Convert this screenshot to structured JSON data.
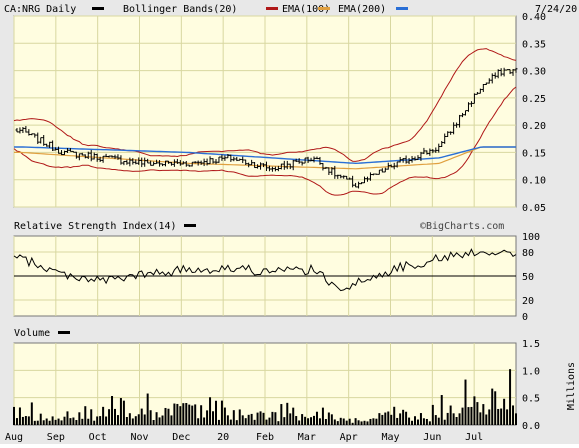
{
  "header": {
    "symbol": "CA:NRG Daily",
    "bollinger": "Bollinger Bands(20)",
    "ema100": "EMA(100)",
    "ema200": "EMA(200)",
    "date": "7/24/20"
  },
  "rsi_panel": {
    "title": "Relative Strength Index(14)",
    "watermark": "©BigCharts.com"
  },
  "volume_panel": {
    "title": "Volume",
    "unit": "Millions"
  },
  "colors": {
    "plot_bg": "#fffde0",
    "grid": "#d8d7a0",
    "price": "#000000",
    "bollinger": "#b01818",
    "ema100": "#e0a040",
    "ema200": "#2a6fd6",
    "volume": "#000000"
  },
  "chart_data": [
    {
      "type": "ohlc",
      "title": "CA:NRG Daily",
      "x_tick_labels": [
        "Aug",
        "Sep",
        "Oct",
        "Nov",
        "Dec",
        "20",
        "Feb",
        "Mar",
        "Apr",
        "May",
        "Jun",
        "Jul"
      ],
      "y_tick_labels": [
        "0.40",
        "0.35",
        "0.30",
        "0.25",
        "0.20",
        "0.15",
        "0.10",
        "0.05"
      ],
      "ylim": [
        0.05,
        0.4
      ],
      "grid": true,
      "series": [
        {
          "name": "Bollinger Bands(20)",
          "key": "bollinger"
        },
        {
          "name": "EMA(100)",
          "key": "ema100"
        },
        {
          "name": "EMA(200)",
          "key": "ema200"
        }
      ],
      "price_points": [
        [
          "Aug",
          0.19
        ],
        [
          "Sep",
          0.15
        ],
        [
          "Oct",
          0.14
        ],
        [
          "Nov",
          0.13
        ],
        [
          "Dec",
          0.13
        ],
        [
          "20",
          0.14
        ],
        [
          "Feb",
          0.12
        ],
        [
          "Mar",
          0.14
        ],
        [
          "Mar",
          0.11
        ],
        [
          "Apr",
          0.09
        ],
        [
          "Apr",
          0.11
        ],
        [
          "May",
          0.13
        ],
        [
          "Jun",
          0.16
        ],
        [
          "Jul",
          0.27
        ],
        [
          "Jul",
          0.3
        ]
      ],
      "ema100_points": [
        [
          "Aug",
          0.15
        ],
        [
          "Dec",
          0.13
        ],
        [
          "Apr",
          0.12
        ],
        [
          "Jun",
          0.13
        ],
        [
          "Jul",
          0.16
        ]
      ],
      "ema200_points": [
        [
          "Aug",
          0.16
        ],
        [
          "Dec",
          0.15
        ],
        [
          "Apr",
          0.13
        ],
        [
          "Jun",
          0.14
        ],
        [
          "Jul",
          0.16
        ]
      ]
    },
    {
      "type": "line",
      "title": "Relative Strength Index(14)",
      "y_tick_labels": [
        "100",
        "80",
        "50",
        "20",
        "0"
      ],
      "ylim": [
        0,
        100
      ],
      "reference_line": 50,
      "points": [
        [
          "Aug",
          72
        ],
        [
          "Sep",
          52
        ],
        [
          "Oct",
          44
        ],
        [
          "Nov",
          52
        ],
        [
          "Dec",
          58
        ],
        [
          "20",
          60
        ],
        [
          "Feb",
          55
        ],
        [
          "Mar",
          58
        ],
        [
          "Mar",
          36
        ],
        [
          "Apr",
          40
        ],
        [
          "May",
          60
        ],
        [
          "Jun",
          72
        ],
        [
          "Jul",
          82
        ],
        [
          "Jul",
          78
        ]
      ]
    },
    {
      "type": "bar",
      "title": "Volume",
      "y_tick_labels": [
        "1.5",
        "1.0",
        "0.5",
        "0.0"
      ],
      "ylabel": "Millions",
      "ylim": [
        0,
        1.5
      ],
      "peaks": [
        [
          "Nov",
          0.5
        ],
        [
          "Dec",
          0.6
        ],
        [
          "Feb",
          0.35
        ],
        [
          "Mar",
          0.4
        ],
        [
          "Apr",
          0.25
        ],
        [
          "May",
          0.4
        ],
        [
          "Jun",
          0.45
        ],
        [
          "Jul",
          1.1
        ],
        [
          "Jul",
          0.95
        ]
      ]
    }
  ]
}
